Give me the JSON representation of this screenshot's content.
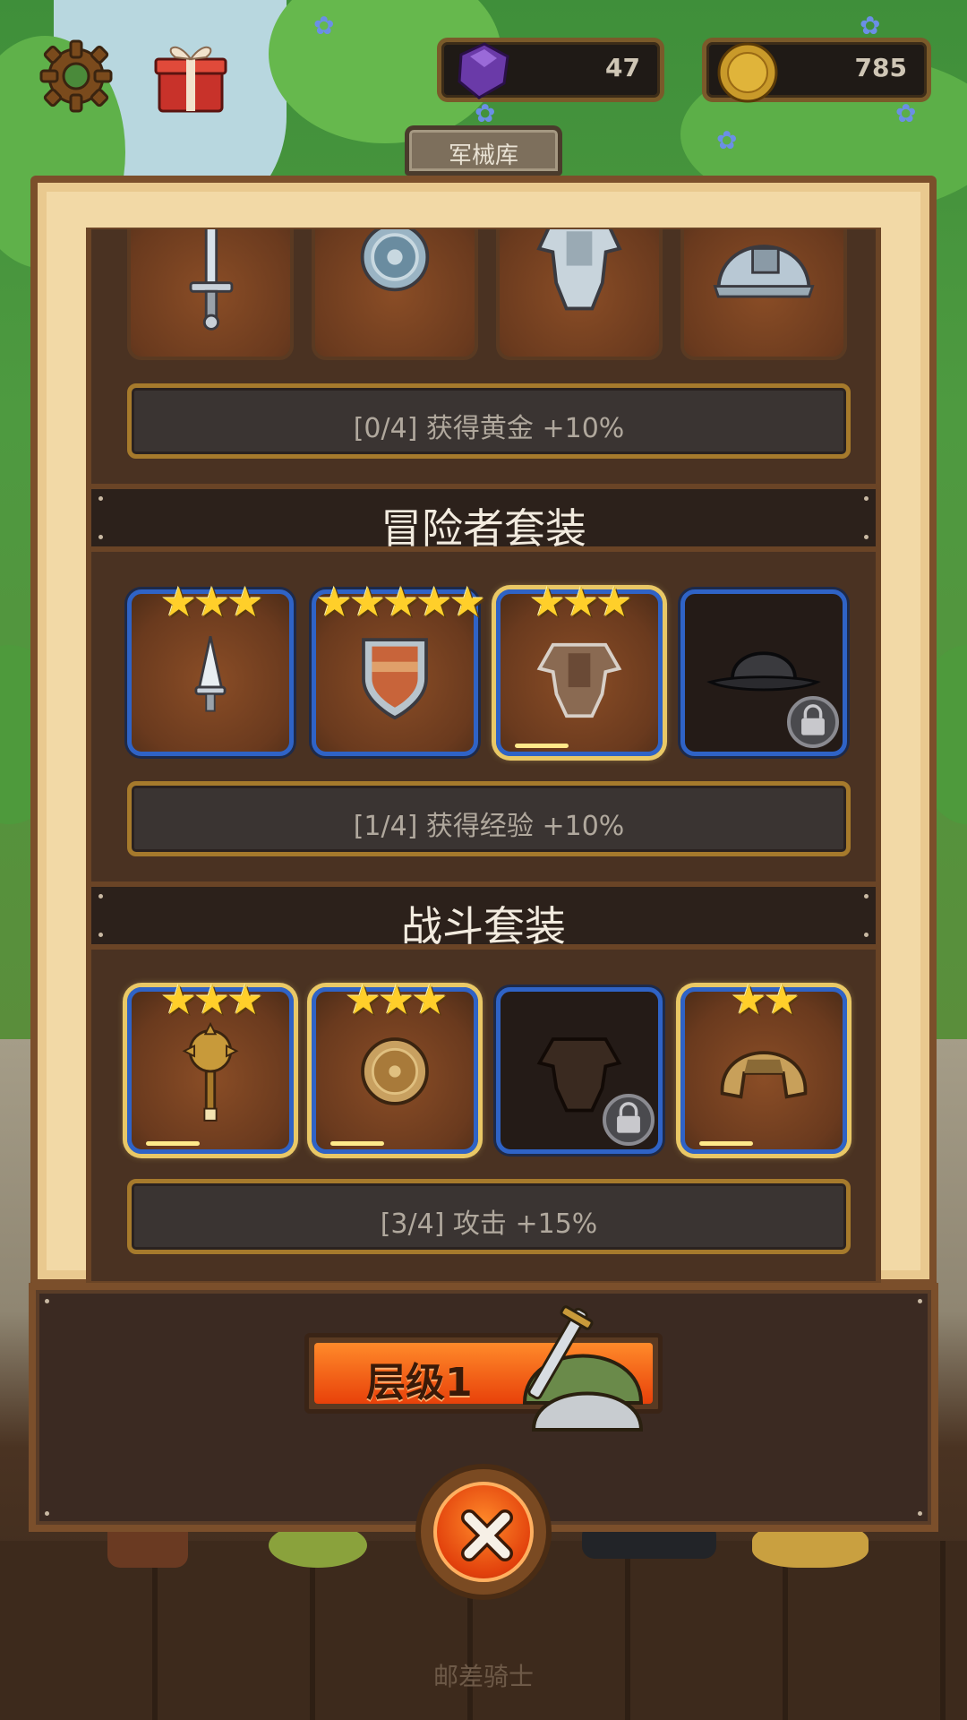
{
  "hud": {
    "gems": "47",
    "coins": "785",
    "gem_icon": "purple-gem-icon",
    "coin_icon": "gold-coin-icon"
  },
  "panel": {
    "tab_title": "军械库"
  },
  "sets": [
    {
      "title": "",
      "bonus": "[0/4] 获得黄金 +10%",
      "items": [
        {
          "icon": "sword-icon",
          "stars": 0,
          "state": "plain"
        },
        {
          "icon": "round-shield-icon",
          "stars": 0,
          "state": "plain"
        },
        {
          "icon": "plate-armor-icon",
          "stars": 0,
          "state": "plain"
        },
        {
          "icon": "steel-helmet-icon",
          "stars": 0,
          "state": "plain"
        }
      ]
    },
    {
      "title": "冒险者套装",
      "bonus": "[1/4] 获得经验 +10%",
      "items": [
        {
          "icon": "dagger-icon",
          "stars": 3,
          "state": "owned"
        },
        {
          "icon": "kite-shield-icon",
          "stars": 5,
          "state": "owned"
        },
        {
          "icon": "leather-armor-icon",
          "stars": 3,
          "state": "gold"
        },
        {
          "icon": "kettle-helmet-icon",
          "stars": 0,
          "state": "locked"
        }
      ]
    },
    {
      "title": "战斗套装",
      "bonus": "[3/4] 攻击 +15%",
      "items": [
        {
          "icon": "mace-icon",
          "stars": 3,
          "state": "gold"
        },
        {
          "icon": "bronze-shield-icon",
          "stars": 3,
          "state": "gold"
        },
        {
          "icon": "dark-armor-icon",
          "stars": 0,
          "state": "locked"
        },
        {
          "icon": "bronze-helmet-icon",
          "stars": 2,
          "state": "gold"
        }
      ]
    }
  ],
  "bottom": {
    "tier_label": "层级1",
    "close_icon": "close-icon"
  },
  "footer": {
    "label": "邮差骑士"
  },
  "colors": {
    "slot_blue": "#2f63c6",
    "star_gold": "#ffcf2a",
    "button_orange": "#e8410a"
  }
}
